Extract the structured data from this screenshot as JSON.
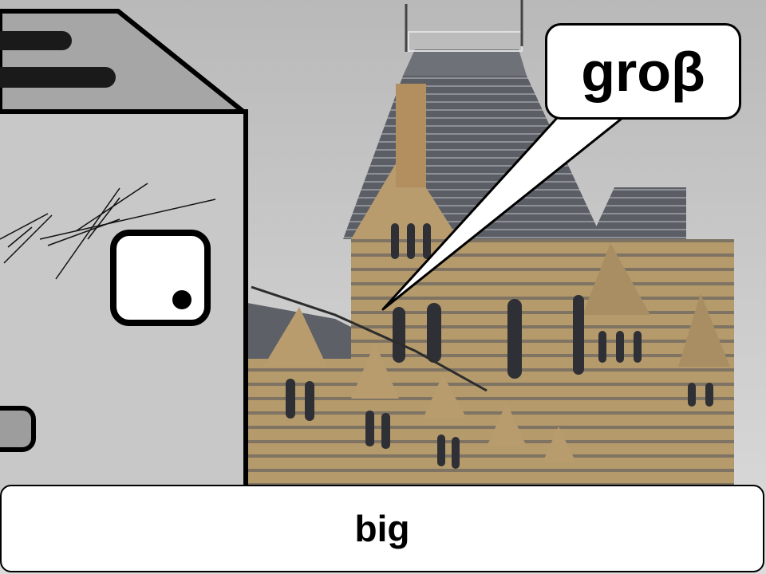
{
  "speech_bubble": {
    "text": "groβ"
  },
  "caption": {
    "text": "big"
  },
  "icons": {
    "speaker": "computer-character-icon",
    "scene": "museum-building-photo"
  },
  "colors": {
    "sky": "#c9c9c9",
    "stone": "#b69a6c",
    "roof": "#5a5d63",
    "character_body": "#c8c8c8",
    "outline": "#000000",
    "bubble": "#ffffff"
  }
}
